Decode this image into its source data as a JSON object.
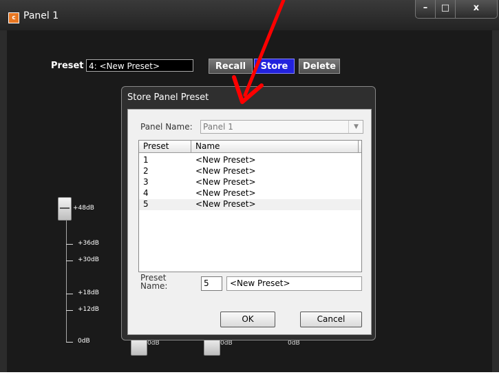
{
  "window": {
    "title": "Panel 1",
    "icon_letter": "c",
    "controls": {
      "minimize": "–",
      "maximize": "□",
      "close": "x"
    }
  },
  "toolbar": {
    "preset_label": "Preset",
    "preset_value": "4: <New Preset>",
    "recall_label": "Recall",
    "store_label": "Store",
    "delete_label": "Delete"
  },
  "fader": {
    "knob_label": "+48dB",
    "scale": [
      "+36dB",
      "+30dB",
      "+18dB",
      "+12dB",
      "0dB"
    ]
  },
  "bottom_faders": [
    "0dB",
    "0dB",
    "0dB"
  ],
  "dialog": {
    "title": "Store Panel Preset",
    "panel_name_label": "Panel Name:",
    "panel_name_value": "Panel 1",
    "columns": [
      "Preset",
      "Name"
    ],
    "rows": [
      {
        "preset": "1",
        "name": "<New Preset>"
      },
      {
        "preset": "2",
        "name": "<New Preset>"
      },
      {
        "preset": "3",
        "name": "<New Preset>"
      },
      {
        "preset": "4",
        "name": "<New Preset>"
      },
      {
        "preset": "5",
        "name": "<New Preset>"
      }
    ],
    "preset_name_label_line1": "Preset",
    "preset_name_label_line2": "Name:",
    "preset_number": "5",
    "preset_name_value": "<New Preset>",
    "ok_label": "OK",
    "cancel_label": "Cancel"
  },
  "colors": {
    "store_button": "#2222dd",
    "annotation_arrow": "#ff0000",
    "window_background": "#1a1a1a"
  }
}
